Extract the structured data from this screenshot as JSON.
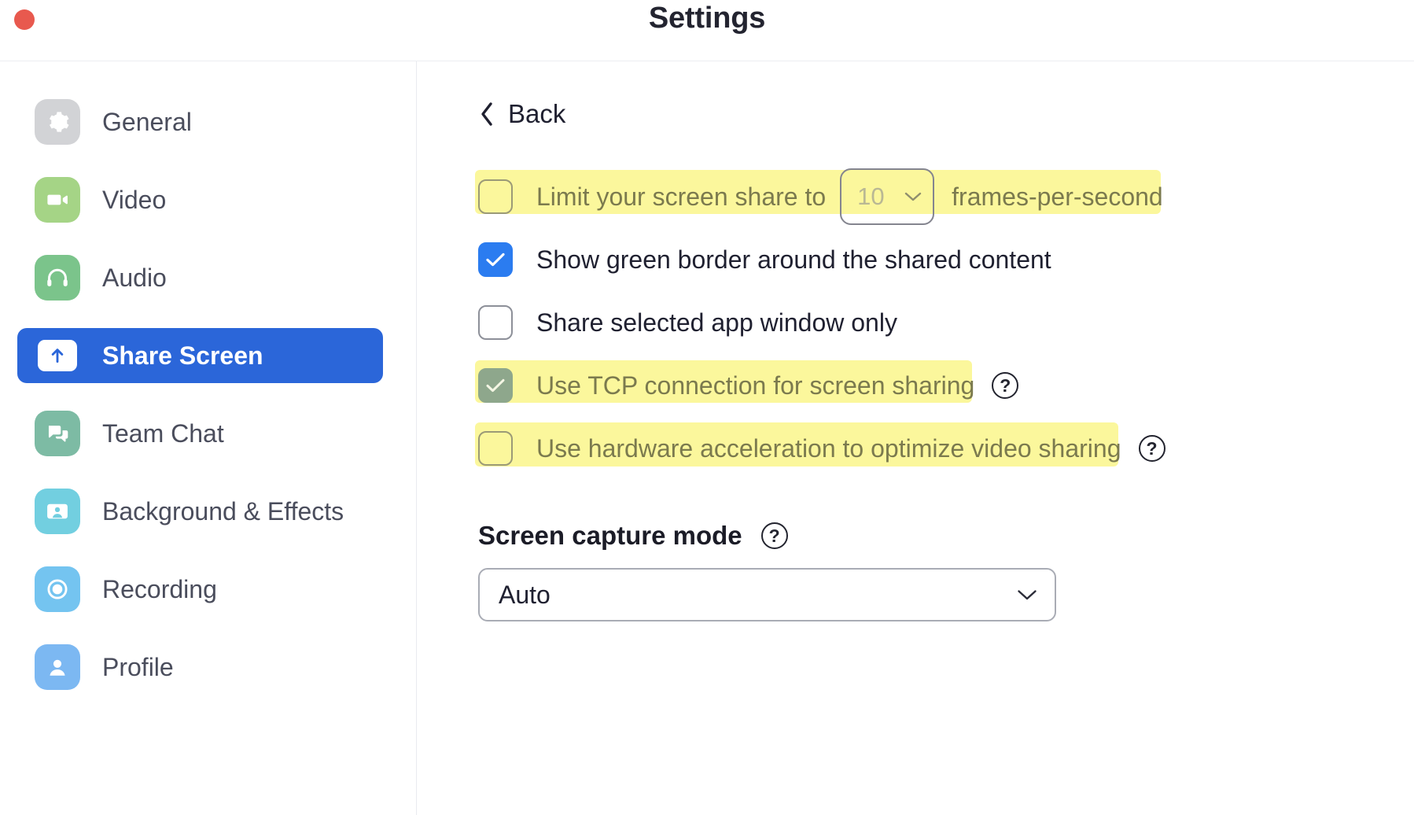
{
  "window": {
    "title": "Settings",
    "close_button": "close"
  },
  "sidebar": {
    "items": [
      {
        "label": "General",
        "icon": "gear-icon",
        "color": "#d2d3d6",
        "selected": false
      },
      {
        "label": "Video",
        "icon": "video-icon",
        "color": "#a5d486",
        "selected": false
      },
      {
        "label": "Audio",
        "icon": "headset-icon",
        "color": "#7bc48b",
        "selected": false
      },
      {
        "label": "Share Screen",
        "icon": "share-up-arrow-icon",
        "color": "#ffffff",
        "selected": true
      },
      {
        "label": "Team Chat",
        "icon": "chat-bubbles-icon",
        "color": "#7dbba4",
        "selected": false
      },
      {
        "label": "Background & Effects",
        "icon": "person-card-icon",
        "color": "#72cfe0",
        "selected": false
      },
      {
        "label": "Recording",
        "icon": "record-circle-icon",
        "color": "#74c4f0",
        "selected": false
      },
      {
        "label": "Profile",
        "icon": "person-icon",
        "color": "#7cb8f2",
        "selected": false
      }
    ],
    "selected_bg": "#2b66d9"
  },
  "main": {
    "back_label": "Back",
    "options": [
      {
        "id": "limit-fps",
        "label": "Limit your screen share to",
        "checked": false,
        "highlighted": true,
        "has_select": true,
        "select_value": "10",
        "suffix": "frames-per-second",
        "has_help": false
      },
      {
        "id": "green-border",
        "label": "Show green border around the shared content",
        "checked": true,
        "highlighted": false,
        "has_select": false,
        "has_help": false
      },
      {
        "id": "selected-app-only",
        "label": "Share selected app window only",
        "checked": false,
        "highlighted": false,
        "has_select": false,
        "has_help": false
      },
      {
        "id": "tcp-connection",
        "label": "Use TCP connection for screen sharing",
        "checked": true,
        "highlighted": true,
        "has_select": false,
        "has_help": true,
        "help_label": "?"
      },
      {
        "id": "hardware-acceleration",
        "label": "Use hardware acceleration to optimize video sharing",
        "checked": false,
        "highlighted": true,
        "has_select": false,
        "has_help": true,
        "help_label": "?"
      }
    ],
    "capture_section": {
      "title": "Screen capture mode",
      "help_label": "?",
      "selected_value": "Auto"
    }
  },
  "colors": {
    "accent_blue": "#2b7cf0",
    "sidebar_selected": "#2b66d9",
    "highlight_yellow": "#fbf79c",
    "close_red": "#e8594e",
    "text_dark": "#1f2030",
    "text_muted": "#7b7a4e"
  }
}
